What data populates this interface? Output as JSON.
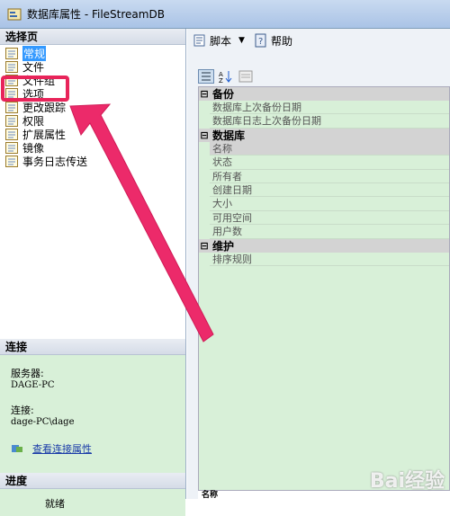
{
  "window": {
    "title": "数据库属性 - FileStreamDB"
  },
  "left": {
    "select_page_header": "选择页",
    "pages": [
      {
        "label": "常规",
        "selected": true
      },
      {
        "label": "文件",
        "selected": false
      },
      {
        "label": "文件组",
        "selected": false
      },
      {
        "label": "选项",
        "selected": false
      },
      {
        "label": "更改跟踪",
        "selected": false
      },
      {
        "label": "权限",
        "selected": false
      },
      {
        "label": "扩展属性",
        "selected": false
      },
      {
        "label": "镜像",
        "selected": false
      },
      {
        "label": "事务日志传送",
        "selected": false
      }
    ],
    "connection_header": "连接",
    "server_label": "服务器:",
    "server_value": "DAGE-PC",
    "connection_label": "连接:",
    "connection_value": "dage-PC\\dage",
    "view_connection_link": "查看连接属性",
    "progress_header": "进度",
    "progress_status": "就绪"
  },
  "toolbar": {
    "script_label": "脚本",
    "help_label": "帮助"
  },
  "grid": {
    "categories": [
      {
        "name": "备份",
        "items": [
          "数据库上次备份日期",
          "数据库日志上次备份日期"
        ]
      },
      {
        "name": "数据库",
        "items": [
          "名称",
          "状态",
          "所有者",
          "创建日期",
          "大小",
          "可用空间",
          "用户数"
        ]
      },
      {
        "name": "维护",
        "items": [
          "排序规则"
        ]
      }
    ],
    "bottom_label": "名称"
  },
  "watermark": "Bai经验"
}
